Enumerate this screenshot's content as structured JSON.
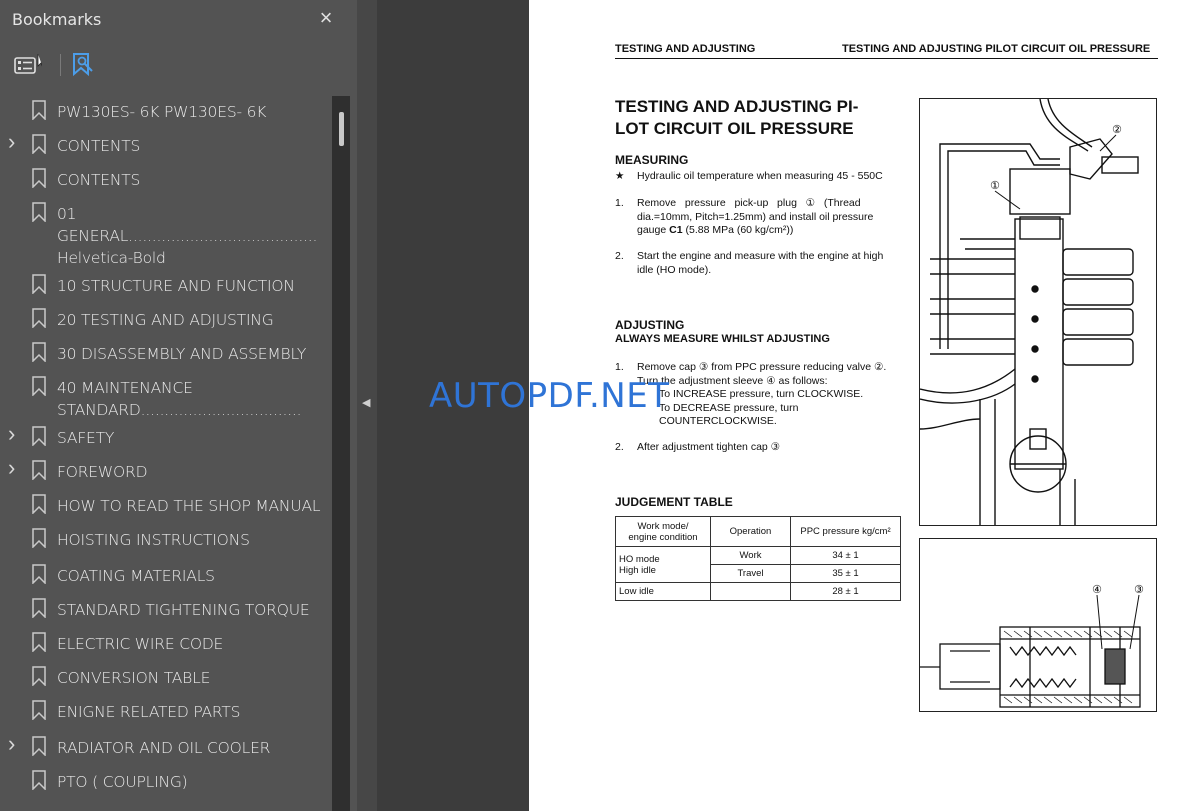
{
  "panel": {
    "title": "Bookmarks",
    "close_icon": "×"
  },
  "bookmarks": [
    {
      "label": "PW130ES- 6K PW130ES- 6K",
      "expandable": false
    },
    {
      "label": "CONTENTS",
      "expandable": true
    },
    {
      "label": "CONTENTS",
      "expandable": false
    },
    {
      "label": "01 GENERAL........................................ Helvetica-Bold",
      "expandable": false
    },
    {
      "label": "10 STRUCTURE AND FUNCTION",
      "expandable": false
    },
    {
      "label": "20 TESTING AND ADJUSTING",
      "expandable": false
    },
    {
      "label": "30 DISASSEMBLY AND ASSEMBLY",
      "expandable": false
    },
    {
      "label": "40 MAINTENANCE STANDARD..................................",
      "expandable": false
    },
    {
      "label": "SAFETY",
      "expandable": true
    },
    {
      "label": "FOREWORD",
      "expandable": true
    },
    {
      "label": "HOW TO READ THE SHOP MANUAL",
      "expandable": false
    },
    {
      "label": "HOISTING INSTRUCTIONS",
      "expandable": false
    },
    {
      "label": "COATING MATERIALS",
      "expandable": false
    },
    {
      "label": "STANDARD TIGHTENING TORQUE",
      "expandable": false
    },
    {
      "label": "ELECTRIC WIRE CODE",
      "expandable": false
    },
    {
      "label": "CONVERSION TABLE",
      "expandable": false
    },
    {
      "label": "ENIGNE RELATED PARTS",
      "expandable": false
    },
    {
      "label": "RADIATOR AND OIL COOLER",
      "expandable": true
    },
    {
      "label": "PTO ( COUPLING)",
      "expandable": false
    }
  ],
  "document": {
    "header_left": "TESTING AND ADJUSTING",
    "header_right": "TESTING AND ADJUSTING PILOT CIRCUIT OIL PRESSURE",
    "title_line1": "TESTING AND ADJUSTING PI-",
    "title_line2": "LOT CIRCUIT OIL PRESSURE",
    "measuring": {
      "heading": "MEASURING",
      "star": "★",
      "note": "Hydraulic oil temperature when measuring 45 - 550C",
      "step1_num": "1.",
      "step1_l1": "Remove   pressure   pick-up   plug   ①   (Thread",
      "step1_l2": "dia.=10mm, Pitch=1.25mm) and install oil pressure",
      "step1_l3_a": "gauge ",
      "step1_l3_b": "C1",
      "step1_l3_c": " (5.88 MPa (60 kg/cm²))",
      "step2_num": "2.",
      "step2_l1": "Start the engine and measure with the engine at high",
      "step2_l2": "idle (HO mode)."
    },
    "adjusting": {
      "heading": "ADJUSTING",
      "subheading": "ALWAYS MEASURE WHILST ADJUSTING",
      "step1_num": "1.",
      "step1_l1": "Remove cap ③ from PPC pressure reducing valve ②.",
      "step1_l2": "Turn the adjustment sleeve ④ as follows:",
      "step1_l3": "To INCREASE pressure, turn CLOCKWISE.",
      "step1_l4": "To DECREASE pressure, turn",
      "step1_l5": "COUNTERCLOCKWISE.",
      "step2_num": "2.",
      "step2_l1": "After adjustment tighten cap ③"
    },
    "judgement": {
      "heading": "JUDGEMENT TABLE",
      "col1_l1": "Work mode/",
      "col1_l2": "engine condition",
      "col2": "Operation",
      "col3": "PPC pressure kg/cm²",
      "row1_mode_l1": "HO mode",
      "row1_mode_l2": "High idle",
      "row1_op1": "Work",
      "row1_val1": "34 ± 1",
      "row1_op2": "Travel",
      "row1_val2": "35 ± 1",
      "row2_mode": "Low idle",
      "row2_val": "28 ± 1"
    },
    "figure_labels": {
      "fig1_label1": "①",
      "fig1_label2": "②",
      "fig2_label4": "④",
      "fig2_label3": "③"
    },
    "watermark": "AUTOPDF.NET"
  },
  "colors": {
    "panel_bg": "#535353",
    "page_bg": "#ffffff",
    "watermark": "#2f74d6"
  }
}
